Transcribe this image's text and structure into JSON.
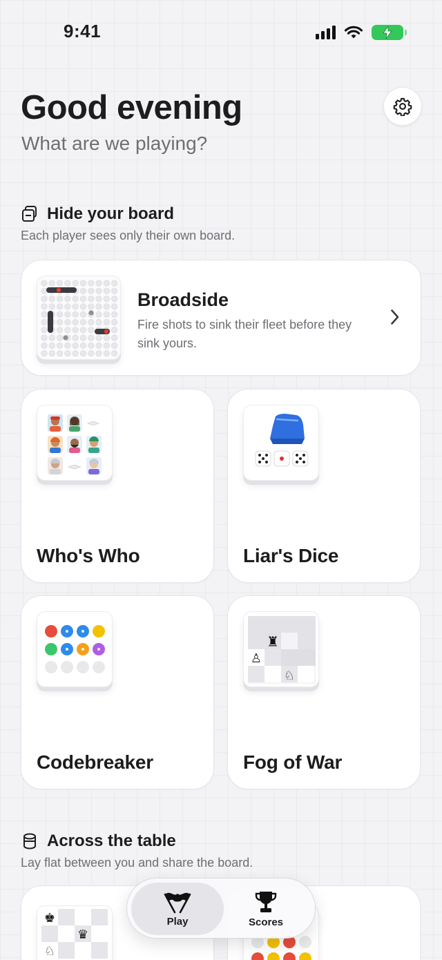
{
  "status": {
    "time": "9:41"
  },
  "header": {
    "greeting": "Good evening",
    "subtitle": "What are we playing?"
  },
  "sections": [
    {
      "title": "Hide your board",
      "description": "Each player sees only their own board.",
      "icon": "hidden-board-icon",
      "featured": {
        "name": "Broadside",
        "description": "Fire shots to sink their fleet before they sink yours."
      },
      "games": [
        {
          "name": "Who's Who"
        },
        {
          "name": "Liar's Dice"
        },
        {
          "name": "Codebreaker"
        },
        {
          "name": "Fog of War"
        }
      ]
    },
    {
      "title": "Across the table",
      "description": "Lay flat between you and share the board.",
      "icon": "table-icon"
    }
  ],
  "tabbar": {
    "items": [
      {
        "label": "Play",
        "icon": "flags-icon",
        "active": true
      },
      {
        "label": "Scores",
        "icon": "trophy-icon",
        "active": false
      }
    ]
  },
  "colors": {
    "background": "#f3f3f6",
    "battery": "#34c759",
    "peg_red": "#e74c3c",
    "peg_blue": "#2e8bea",
    "peg_yellow": "#f2c200",
    "peg_green": "#3cc66b",
    "peg_orange": "#f59f1a",
    "peg_purple": "#b05ce6",
    "dice_cup": "#2f6fe0"
  }
}
